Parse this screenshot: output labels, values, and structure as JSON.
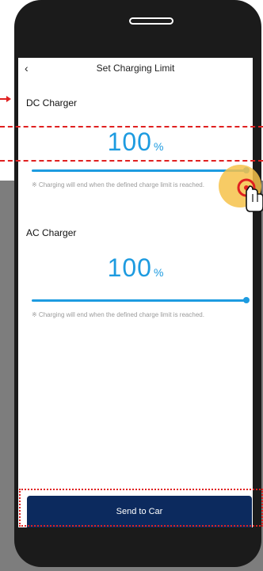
{
  "header": {
    "title": "Set Charging Limit",
    "back_icon": "chevron-left-icon"
  },
  "dc": {
    "label": "DC Charger",
    "value": "100",
    "unit": "%",
    "slider_fraction": 1.0,
    "note": "※ Charging will end when the defined charge limit is reached."
  },
  "ac": {
    "label": "AC Charger",
    "value": "100",
    "unit": "%",
    "slider_fraction": 1.0,
    "note": "※ Charging will end when the defined charge limit is reached."
  },
  "footer": {
    "send_label": "Send to Car"
  },
  "colors": {
    "accent": "#1d9be0",
    "button": "#0c2a5e",
    "highlight": "#e02020",
    "tap": "#f6c24a"
  }
}
